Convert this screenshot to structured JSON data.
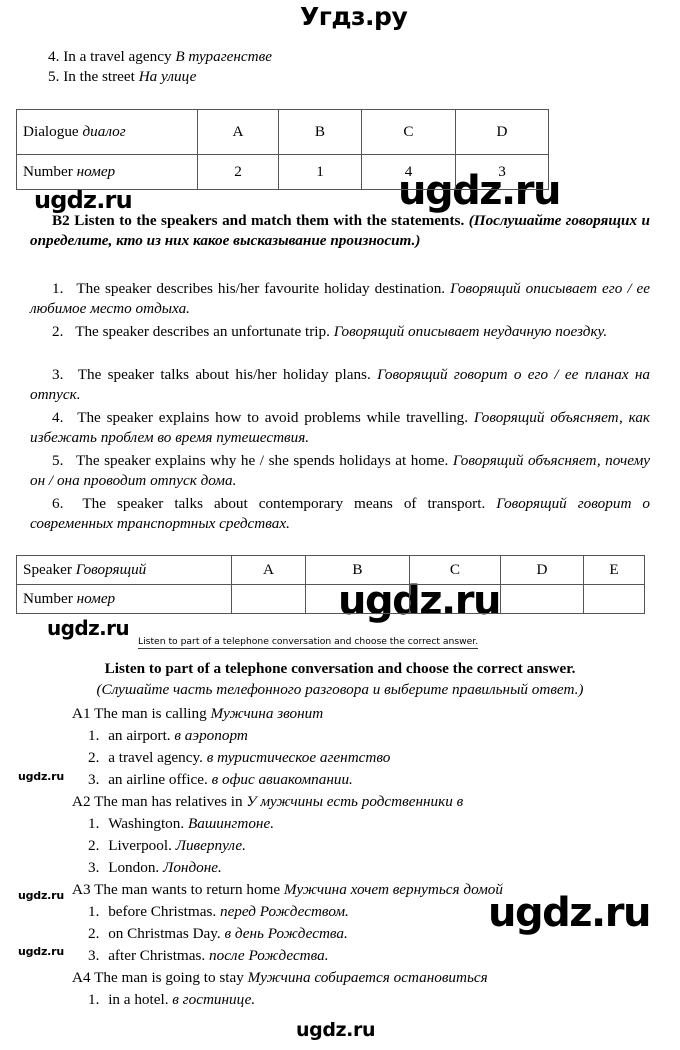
{
  "watermarks": {
    "header": "Угдз.ру",
    "big": "ugdz.ru",
    "mid": "ugdz.ru",
    "small": "ugdz.ru",
    "footer": "ugdz.ru"
  },
  "top_items": [
    {
      "num": "4.",
      "en": "In a travel agency",
      "ru": "В турагенстве"
    },
    {
      "num": "5.",
      "en": "In the street",
      "ru": "На улице"
    }
  ],
  "table_dialogue": {
    "row_labels": [
      {
        "en": "Dialogue ",
        "ru": "диалог"
      },
      {
        "en": "Number ",
        "ru": "номер"
      }
    ],
    "columns": [
      "A",
      "B",
      "C",
      "D"
    ],
    "numbers": [
      "2",
      "1",
      "4",
      "3"
    ]
  },
  "task_b2": {
    "code": "B2",
    "title_en": "Listen to the speakers and match them with the statements",
    "title_ru": "(Послушайте говорящих и определите, кто из них какое высказывание произносит.)",
    "statements": [
      {
        "num": "1.",
        "en": "The speaker describes his/her favourite holiday destination.",
        "ru": "Говорящий описывает его / ее любимое место отдыха."
      },
      {
        "num": "2.",
        "en": "The speaker describes an unfortunate trip.",
        "ru": "Говорящий описывает неудачную поездку."
      },
      {
        "num": "3.",
        "en": "The speaker talks about his/her holiday plans.",
        "ru": "Говорящий говорит о его / ее планах на отпуск."
      },
      {
        "num": "4.",
        "en": "The speaker explains how to avoid problems while travelling.",
        "ru": "Говорящий объясняет, как избежать проблем во время путешествия."
      },
      {
        "num": "5.",
        "en": "The speaker explains why he / she spends holidays at home.",
        "ru": "Говорящий объясняет, почему он / она проводит отпуск дома."
      },
      {
        "num": "6.",
        "en": "The speaker talks about contemporary means of transport.",
        "ru": "Говорящий говорит о современных транспортных средствах."
      }
    ]
  },
  "table_speaker": {
    "row_labels": [
      {
        "en": "Speaker ",
        "ru": "Говорящий"
      },
      {
        "en": "Number ",
        "ru": "номер"
      }
    ],
    "columns": [
      "A",
      "B",
      "C",
      "D",
      "E"
    ],
    "numbers": [
      "",
      "",
      "",
      "",
      ""
    ]
  },
  "caption_small": "Listen to part of a telephone conversation and choose the correct answer.",
  "task_a": {
    "title_en": "Listen to part of a telephone conversation and choose the correct answer.",
    "title_ru": "(Слушайте часть телефонного разговора и выберите правильный ответ.)",
    "questions": [
      {
        "code": "A1",
        "stem_en": "The man is calling",
        "stem_ru": "Мужчина звонит",
        "options": [
          {
            "num": "1.",
            "en": "an airport.",
            "ru": "в аэропорт"
          },
          {
            "num": "2.",
            "en": "a travel agency.",
            "ru": "в туристическое агентство"
          },
          {
            "num": "3.",
            "en": "an airline office.",
            "ru": "в офис авиакомпании."
          }
        ]
      },
      {
        "code": "A2",
        "stem_en": "The man has relatives in",
        "stem_ru": "У мужчины есть родственники в",
        "options": [
          {
            "num": "1.",
            "en": "Washington.",
            "ru": "Вашингтоне."
          },
          {
            "num": "2.",
            "en": "Liverpool.",
            "ru": "Ливерпуле."
          },
          {
            "num": "3.",
            "en": "London.",
            "ru": "Лондоне."
          }
        ]
      },
      {
        "code": "A3",
        "stem_en": "The man wants to return home",
        "stem_ru": "Мужчина хочет вернуться домой",
        "options": [
          {
            "num": "1.",
            "en": "before Christmas.",
            "ru": "перед Рождеством."
          },
          {
            "num": "2.",
            "en": "on Christmas Day.",
            "ru": "в день Рождества."
          },
          {
            "num": "3.",
            "en": "after Christmas.",
            "ru": "после Рождества."
          }
        ]
      },
      {
        "code": "A4",
        "stem_en": "The man is going to stay",
        "stem_ru": "Мужчина собирается остановиться",
        "options": [
          {
            "num": "1.",
            "en": "in a hotel.",
            "ru": "в гостинице."
          }
        ]
      }
    ]
  }
}
